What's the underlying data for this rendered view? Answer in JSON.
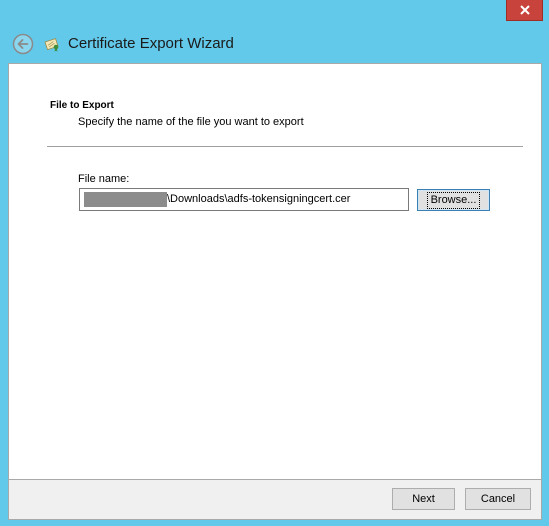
{
  "window": {
    "title": "Certificate Export Wizard",
    "close_icon": "close-icon",
    "back_icon": "back-arrow-icon",
    "wizard_icon": "certificate-icon"
  },
  "page": {
    "section_title": "File to Export",
    "section_description": "Specify the name of the file you want to export"
  },
  "file_name": {
    "label": "File name:",
    "value": "\\Downloads\\adfs-tokensigningcert.cer",
    "browse_label": "Browse..."
  },
  "footer": {
    "next_label": "Next",
    "cancel_label": "Cancel"
  },
  "colors": {
    "frame": "#63c9ea",
    "close_button": "#c7433b",
    "content_bg": "#ffffff",
    "footer_bg": "#f0f0f0"
  }
}
